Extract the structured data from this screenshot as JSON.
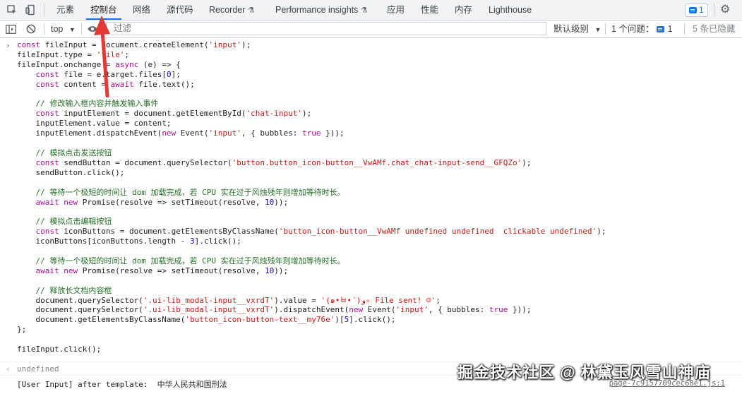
{
  "tabbar": {
    "tabs": [
      "元素",
      "控制台",
      "网络",
      "源代码",
      "Recorder",
      "Performance insights",
      "应用",
      "性能",
      "内存",
      "Lighthouse"
    ],
    "active_tab": "控制台",
    "issues_badge": "1",
    "icons": [
      "inspect-element-icon",
      "device-toolbar-icon",
      "recorder-flask-icon",
      "performance-flask-icon",
      "settings-gear-icon"
    ]
  },
  "toolbar": {
    "context": "top",
    "filter_placeholder": "过滤",
    "levels": "默认级别",
    "issues_text": "1 个问题：",
    "issues_count": "1",
    "hidden_count": "5 条已隐藏"
  },
  "console": {
    "result": "undefined",
    "log_text": "[User Input] after template:  中华人民共和国刑法",
    "log_source": "page-7c9157709cec68e1.js:1"
  },
  "watermark": "掘金技术社区 @ 林黛玉风雪山神庙",
  "colors": {
    "accent": "#1a73e8",
    "annotation_arrow": "#e53935"
  }
}
